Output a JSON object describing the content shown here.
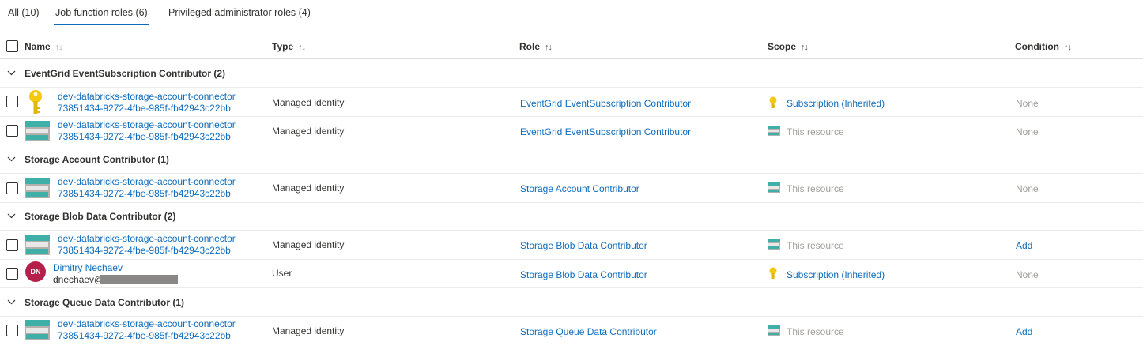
{
  "tabs": [
    {
      "label": "All (10)",
      "active": false
    },
    {
      "label": "Job function roles (6)",
      "active": true
    },
    {
      "label": "Privileged administrator roles (4)",
      "active": false
    }
  ],
  "columns": {
    "name": "Name",
    "type": "Type",
    "role": "Role",
    "scope": "Scope",
    "condition": "Condition",
    "sort_glyph": "↑↓"
  },
  "groups": [
    {
      "title": "EventGrid EventSubscription Contributor (2)",
      "rows": [
        {
          "icon": "key-icon",
          "name1": "dev-databricks-storage-account-connector",
          "name2": "73851434-9272-4fbe-985f-fb42943c22bb",
          "type": "Managed identity",
          "role": "EventGrid EventSubscription Contributor",
          "scope_icon": "key-icon",
          "scope": "Subscription (Inherited)",
          "condition": "None"
        },
        {
          "icon": "storage-account-icon",
          "name1": "dev-databricks-storage-account-connector",
          "name2": "73851434-9272-4fbe-985f-fb42943c22bb",
          "type": "Managed identity",
          "role": "EventGrid EventSubscription Contributor",
          "scope_icon": "storage-account-icon",
          "scope": "This resource",
          "condition": "None"
        }
      ]
    },
    {
      "title": "Storage Account Contributor (1)",
      "rows": [
        {
          "icon": "storage-account-icon",
          "name1": "dev-databricks-storage-account-connector",
          "name2": "73851434-9272-4fbe-985f-fb42943c22bb",
          "type": "Managed identity",
          "role": "Storage Account Contributor",
          "scope_icon": "storage-account-icon",
          "scope": "This resource",
          "condition": "None"
        }
      ]
    },
    {
      "title": "Storage Blob Data Contributor (2)",
      "rows": [
        {
          "icon": "storage-account-icon",
          "name1": "dev-databricks-storage-account-connector",
          "name2": "73851434-9272-4fbe-985f-fb42943c22bb",
          "type": "Managed identity",
          "role": "Storage Blob Data Contributor",
          "scope_icon": "storage-account-icon",
          "scope": "This resource",
          "condition": "Add"
        },
        {
          "icon": "avatar",
          "avatar_initials": "DN",
          "name1": "Dimitry Nechaev",
          "name2": "dnechaev@",
          "type": "User",
          "role": "Storage Blob Data Contributor",
          "scope_icon": "key-icon",
          "scope": "Subscription (Inherited)",
          "condition": "None"
        }
      ]
    },
    {
      "title": "Storage Queue Data Contributor (1)",
      "rows": [
        {
          "icon": "storage-account-icon",
          "name1": "dev-databricks-storage-account-connector",
          "name2": "73851434-9272-4fbe-985f-fb42943c22bb",
          "type": "Managed identity",
          "role": "Storage Queue Data Contributor",
          "scope_icon": "storage-account-icon",
          "scope": "This resource",
          "condition": "Add"
        }
      ]
    }
  ],
  "colors": {
    "accent": "#0f6cbd",
    "avatar": "#b5204a",
    "key": "#f2c811",
    "storage": "#3fb0a8"
  }
}
